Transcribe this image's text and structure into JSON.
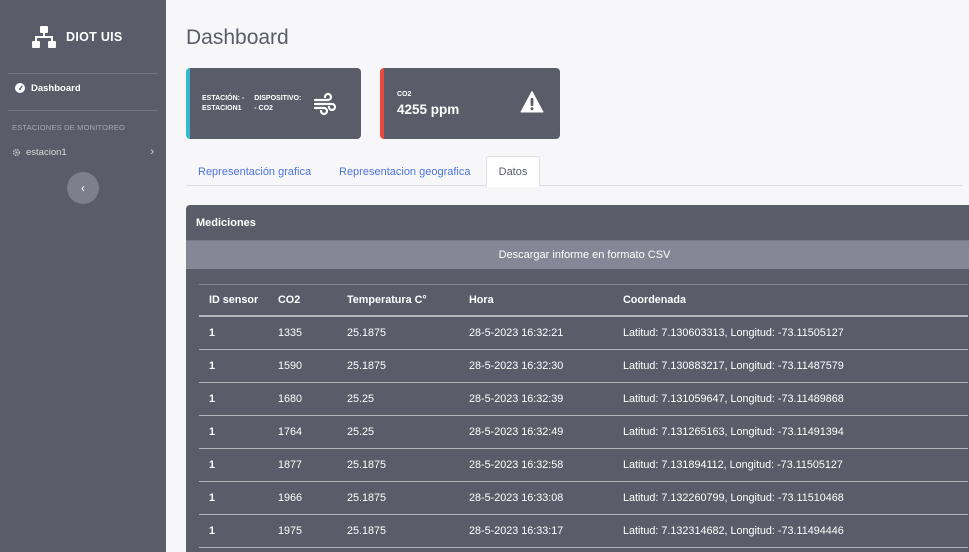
{
  "sidebar": {
    "brand": "DIOT UIS",
    "nav_dashboard": "Dashboard",
    "section_heading": "ESTACIONES DE MONITOREO",
    "station": "estacion1"
  },
  "header": {
    "title": "Dashboard"
  },
  "cards": {
    "station": {
      "col1_line1": "ESTACIÓN: -",
      "col1_line2": "ESTACION1",
      "col2_line1": "DISPOSITIVO:",
      "col2_line2": "- CO2"
    },
    "co2": {
      "label": "CO2",
      "value": "4255 ppm"
    }
  },
  "tabs": [
    "Representación grafica",
    "Representacion geografica",
    "Datos"
  ],
  "panel": {
    "title": "Mediciones",
    "csv_button": "Descargar informe en formato CSV"
  },
  "table": {
    "headers": [
      "ID sensor",
      "CO2",
      "Temperatura C°",
      "Hora",
      "Coordenada"
    ],
    "rows": [
      [
        "1",
        "1335",
        "25.1875",
        "28-5-2023 16:32:21",
        "Latitud: 7.130603313, Longitud: -73.11505127"
      ],
      [
        "1",
        "1590",
        "25.1875",
        "28-5-2023 16:32:30",
        "Latitud: 7.130883217, Longitud: -73.11487579"
      ],
      [
        "1",
        "1680",
        "25.25",
        "28-5-2023 16:32:39",
        "Latitud: 7.131059647, Longitud: -73.11489868"
      ],
      [
        "1",
        "1764",
        "25.25",
        "28-5-2023 16:32:49",
        "Latitud: 7.131265163, Longitud: -73.11491394"
      ],
      [
        "1",
        "1877",
        "25.1875",
        "28-5-2023 16:32:58",
        "Latitud: 7.131894112, Longitud: -73.11505127"
      ],
      [
        "1",
        "1966",
        "25.1875",
        "28-5-2023 16:33:08",
        "Latitud: 7.132260799, Longitud: -73.11510468"
      ],
      [
        "1",
        "1975",
        "25.1875",
        "28-5-2023 16:33:17",
        "Latitud: 7.132314682, Longitud: -73.11494446"
      ]
    ]
  },
  "colors": {
    "sidebar_bg": "#5a5c69",
    "card_info_border": "#36b9cc",
    "card_danger_border": "#e74a3b",
    "link": "#4e73df",
    "csv_button_bg": "#858796"
  },
  "icons": {
    "brand": "network-icon",
    "dashboard": "tachometer-icon",
    "station": "gear-icon",
    "station_expand": "chevron-right-icon",
    "sidebar_toggle": "chevron-left-icon",
    "card_station": "wind-icon",
    "card_co2": "warning-triangle-icon"
  }
}
